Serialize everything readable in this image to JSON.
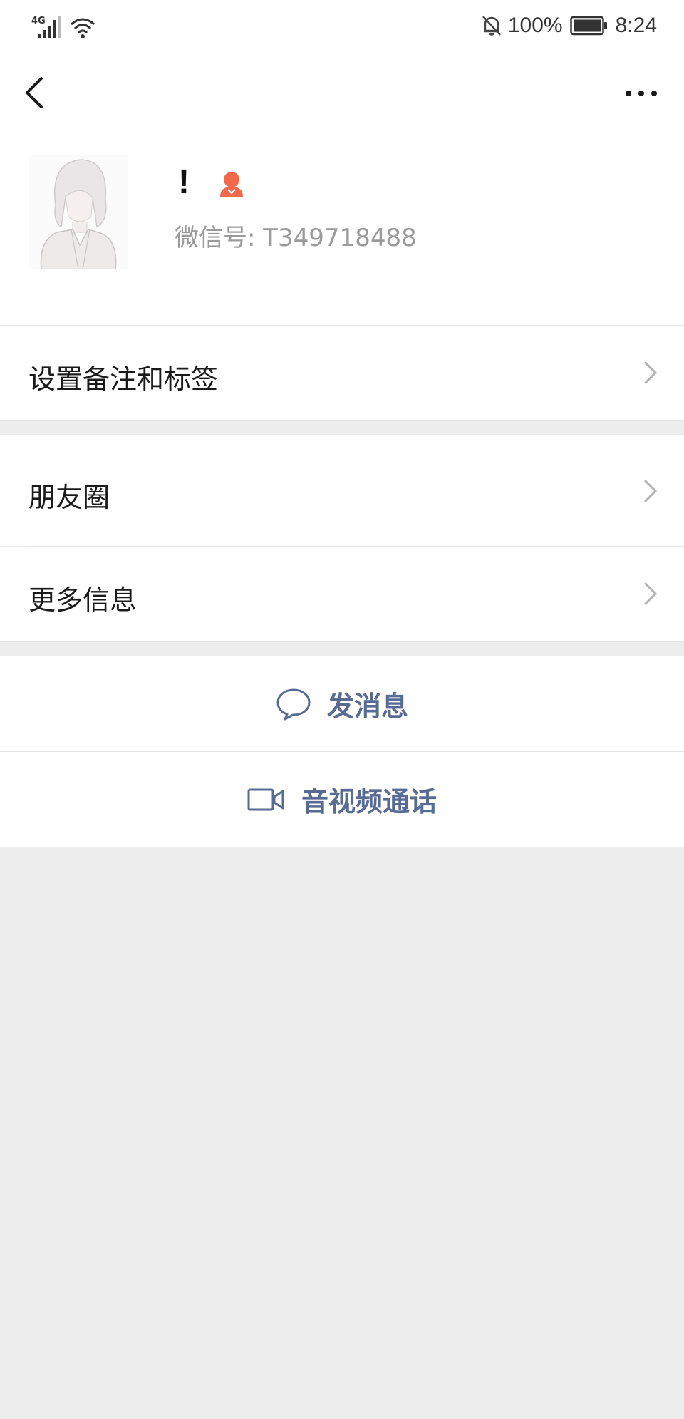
{
  "status_bar": {
    "network": "4G",
    "signal_icon": "cellular-signal-icon",
    "wifi_icon": "wifi-icon",
    "mute_icon": "bell-off-icon",
    "battery": "100%",
    "battery_level": 1.0,
    "time": "8:24"
  },
  "nav": {
    "back_icon": "chevron-left-icon",
    "more_icon": "more-dots-icon"
  },
  "profile": {
    "nickname": "!",
    "contact_icon": "person-badge-icon",
    "wechat_id": "微信号: T349718488",
    "accent_color": "#f0694a"
  },
  "cells": {
    "remark": "设置备注和标签",
    "moments": "朋友圈",
    "more_info": "更多信息"
  },
  "actions": {
    "send_message": "发消息",
    "av_call": "音视频通话",
    "link_color": "#576b95"
  }
}
